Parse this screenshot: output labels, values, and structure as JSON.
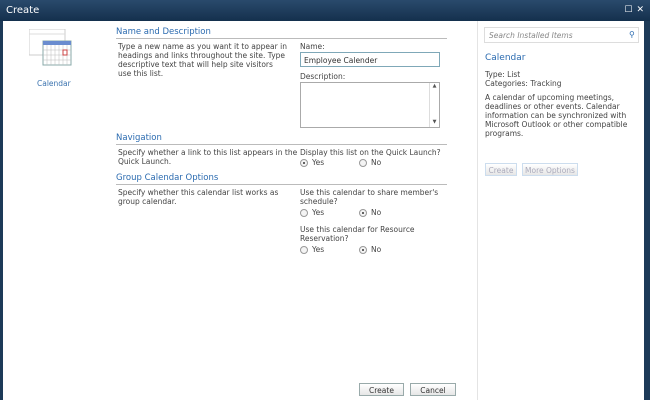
{
  "window": {
    "title": "Create"
  },
  "left": {
    "item_label": "Calendar"
  },
  "sections": {
    "name": {
      "title": "Name and Description",
      "desc": "Type a new name as you want it to appear in headings and links throughout the site. Type descriptive text that will help site visitors use this list.",
      "name_label": "Name:",
      "name_value": "Employee Calender",
      "desc_label": "Description:",
      "desc_value": ""
    },
    "nav": {
      "title": "Navigation",
      "desc": "Specify whether a link to this list appears in the Quick Launch.",
      "question": "Display this list on the Quick Launch?",
      "yes": "Yes",
      "no": "No",
      "selected": "Yes"
    },
    "group": {
      "title": "Group Calendar Options",
      "desc": "Specify whether this calendar list works as group calendar.",
      "q1": "Use this calendar to share member's schedule?",
      "q1_selected": "No",
      "q2": "Use this calendar for Resource Reservation?",
      "q2_selected": "No",
      "yes": "Yes",
      "no": "No"
    }
  },
  "buttons": {
    "create": "Create",
    "cancel": "Cancel"
  },
  "side": {
    "search_placeholder": "Search Installed Items",
    "title": "Calendar",
    "type": "Type: List",
    "categories": "Categories: Tracking",
    "description": "A calendar of upcoming meetings, deadlines or other events.  Calendar information can be synchronized with Microsoft Outlook or other compatible programs.",
    "create": "Create",
    "more": "More Options"
  }
}
